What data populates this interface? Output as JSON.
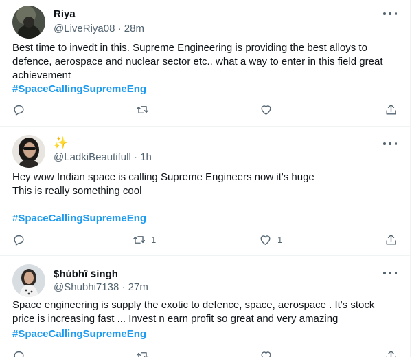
{
  "tweets": [
    {
      "name": "Riya",
      "handle": "@LiveRiya08",
      "separator": "·",
      "time": "28m",
      "text": "Best time to invedt in this. Supreme Engineering is providing the best alloys to defence, aerospace and nuclear sector etc.. what a way to enter in this field great achievement",
      "hashtag": "#SpaceCallingSupremeEng",
      "retweets": "",
      "likes": ""
    },
    {
      "name": "✨",
      "handle": "@LadkiBeautifull",
      "separator": "·",
      "time": "1h",
      "text_line1": "Hey wow Indian space is calling Supreme Engineers now it's huge",
      "text_line2": "This is really something cool",
      "hashtag": "#SpaceCallingSupremeEng",
      "retweets": "1",
      "likes": "1"
    },
    {
      "name": "$húbhî ꜱingh",
      "handle": "@Shubhi7138",
      "separator": "·",
      "time": "27m",
      "text": "Space engineering is supply the exotic to defence, space, aerospace . It's stock price is increasing fast ... Invest n earn profit so great and very amazing",
      "hashtag": "#SpaceCallingSupremeEng",
      "retweets": "",
      "likes": ""
    }
  ],
  "colors": {
    "accent": "#1d9bf0",
    "secondary_text": "#536471",
    "primary_text": "#0f1419",
    "divider": "#eff3f4"
  },
  "icons": [
    "reply-icon",
    "retweet-icon",
    "like-icon",
    "share-icon",
    "more-icon"
  ]
}
